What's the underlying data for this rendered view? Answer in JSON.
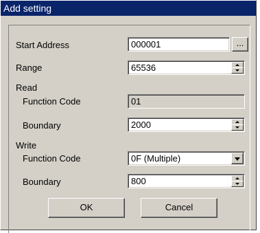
{
  "window": {
    "title": "Add setting"
  },
  "labels": {
    "start_address": "Start Address",
    "range": "Range",
    "read_section": "Read",
    "read_function_code": "Function Code",
    "read_boundary": "Boundary",
    "write_section": "Write",
    "write_function_code": "Function Code",
    "write_boundary": "Boundary"
  },
  "fields": {
    "start_address": "000001",
    "range": "65536",
    "read_function_code": "01",
    "read_boundary": "2000",
    "write_function_code": "0F (Multiple)",
    "write_boundary": "800"
  },
  "buttons": {
    "browse": "...",
    "ok": "OK",
    "cancel": "Cancel"
  },
  "icons": {
    "spin": "spin-arrows-icon",
    "dropdown": "chevron-down-icon"
  },
  "colors": {
    "titlebar": "#0a246a",
    "face": "#d4d0c8",
    "field": "#ffffff"
  }
}
